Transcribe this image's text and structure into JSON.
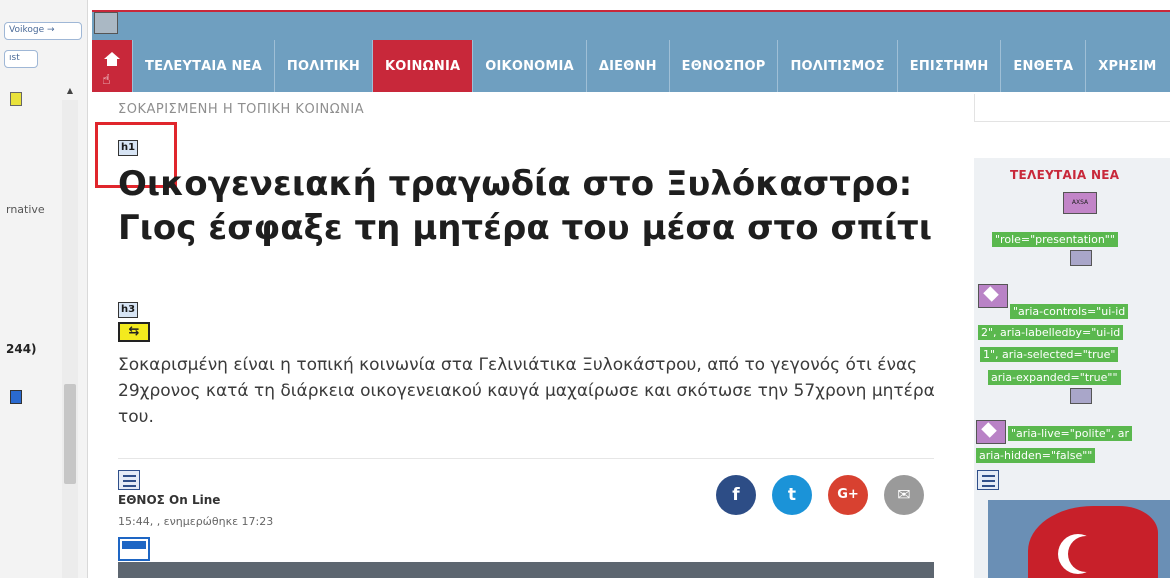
{
  "left_panel": {
    "chip1": "Voikoge →",
    "chip2": "ıst",
    "text1": "rnative",
    "text2": "244)"
  },
  "nav": {
    "items": [
      {
        "label": "ΤΕΛΕΥΤΑΙΑ ΝΕΑ"
      },
      {
        "label": "ΠΟΛΙΤΙΚΗ"
      },
      {
        "label": "ΚΟΙΝΩΝΙΑ",
        "active": true
      },
      {
        "label": "ΟΙΚΟΝΟΜΙΑ"
      },
      {
        "label": "ΔΙΕΘΝΗ"
      },
      {
        "label": "ΕΘΝΟΣΠΟΡ"
      },
      {
        "label": "ΠΟΛΙΤΙΣΜΟΣ"
      },
      {
        "label": "ΕΠΙΣΤΗΜΗ"
      },
      {
        "label": "ΕΝΘΕΤΑ"
      },
      {
        "label": "ΧΡΗΣΙΜ"
      }
    ]
  },
  "breadcrumb": "ΣΟΚΑΡΙΣΜΕΝΗ Η ΤΟΠΙΚΗ ΚΟΙΝΩΝΙΑ",
  "article": {
    "h1_tag": "h1",
    "h3_tag": "h3",
    "title": "Οικογενειακή τραγωδία στο Ξυλόκαστρο: Γιος έσφαξε τη μητέρα του μέσα στο σπίτι",
    "lead": "Σοκαρισμένη είναι η τοπική κοινωνία στα Γελινιάτικα Ξυλοκάστρου, από το γεγονός ότι ένας 29χρονος κατά τη διάρκεια οικογενειακού καυγά μαχαίρωσε και σκότωσε την 57χρονη μητέρα του.",
    "author": "ΕΘΝΟΣ On Line",
    "time": "15:44, , ενημερώθηκε 17:23"
  },
  "share": {
    "facebook": "f",
    "twitter": "t",
    "googleplus": "G+",
    "email": "✉"
  },
  "sidebar": {
    "title": "ΤΕΛΕΥΤΑΙΑ ΝΕΑ",
    "badge": "AXSA",
    "labels": [
      "\"role=\"presentation\"\"",
      "\"aria-controls=\"ui-id",
      "2\", aria-labelledby=\"ui-id",
      "1\", aria-selected=\"true\"",
      "aria-expanded=\"true\"\"",
      "\"aria-live=\"polite\", ar",
      "aria-hidden=\"false\"\""
    ]
  },
  "icons": [
    "home-icon",
    "pointer-hand-icon",
    "heading-tag-icon",
    "arrow-icon",
    "list-icon",
    "image-icon",
    "facebook-icon",
    "twitter-icon",
    "googleplus-icon",
    "email-icon",
    "tag-icon"
  ],
  "colors": {
    "accent_red": "#c8283a",
    "nav_blue": "#6f9fc0",
    "highlight_green": "#5ab84e"
  }
}
